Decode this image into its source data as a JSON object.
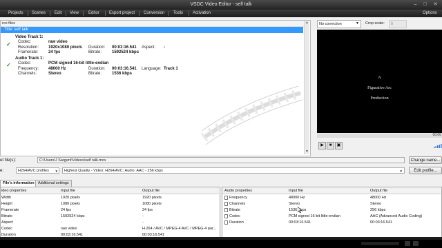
{
  "window": {
    "title": "VSDC Video Editor - self talk"
  },
  "menu": [
    "Projects",
    "Scenes",
    "Edit",
    "View",
    "Editor",
    "Export project",
    "Conversion",
    "Tools",
    "Activation"
  ],
  "menu_right": "Options",
  "source": {
    "header": "rce files",
    "title_row": "Title: self talk",
    "video_track": {
      "heading": "Video Track 1:",
      "codec_k": "Codec:",
      "codec_v": "raw video",
      "res_k": "Resolution:",
      "res_v": "1920x1080 pixels",
      "dur_k": "Duration:",
      "dur_v": "00:03:16.541",
      "aspect_k": "Aspect:",
      "aspect_v": "-",
      "fr_k": "Framerate:",
      "fr_v": "24 fps",
      "br_k": "Bitrate:",
      "br_v": "1592524 kbps"
    },
    "audio_track": {
      "heading": "Audio Track 1:",
      "codec_k": "Codec:",
      "codec_v": "PCM signed 16-bit little-endian",
      "freq_k": "Frequency:",
      "freq_v": "48000 Hz",
      "dur_k": "Duration:",
      "dur_v": "00:03:16.541",
      "lang_k": "Language:",
      "lang_v": "Track 1",
      "ch_k": "Channels:",
      "ch_v": "Stereo",
      "br_k": "Bitrate:",
      "br_v": "1536 kbps"
    }
  },
  "preview": {
    "correction": "No correction",
    "crop_label": "Crop scale:",
    "crop_value": "0",
    "lines": [
      "A",
      "Figurative Arc",
      "Production"
    ],
    "time": "00:00"
  },
  "io": {
    "input_label": "ut file(s):",
    "input_value": "C:\\Users\\J Sargent\\Videos\\self talk.mov",
    "change_btn": "Change name...",
    "profile_label": "e:",
    "format_value": "H264/AVC profiles",
    "quality_value": "Highest Quality - Video: H264/AVC; Audio: AAC - 256 kbps",
    "edit_btn": "Edit profile..."
  },
  "tabs": [
    "File's information",
    "Additional settings"
  ],
  "video_props": {
    "headers": [
      "ideo properties",
      "Input file",
      "Output file"
    ],
    "rows": [
      [
        "Width",
        "1920 pixels",
        "1920 pixels"
      ],
      [
        "Height",
        "1080 pixels",
        "1080 pixels"
      ],
      [
        "Framerate",
        "24 fps",
        "24 fps"
      ],
      [
        "Bitrate",
        "1592524 kbps",
        "-"
      ],
      [
        "Aspect",
        "-",
        "-"
      ],
      [
        "Codec",
        "raw video",
        "H.264 / AVC / MPEG-4 AVC / MPEG-4 par..."
      ],
      [
        "Duration",
        "00:03:16.541",
        "00:03:16.541"
      ]
    ]
  },
  "audio_props": {
    "headers": [
      "Audio properties",
      "Input file",
      "Output file"
    ],
    "rows": [
      [
        "Frequency",
        "48000 Hz",
        "48000 Hz"
      ],
      [
        "Channels",
        "Stereo",
        "Stereo"
      ],
      [
        "Bitrate",
        "1536 kbps",
        "256 kbps"
      ],
      [
        "Codec",
        "PCM signed 16-bit little-endian",
        "AAC (Advanced Audio Coding)"
      ],
      [
        "Duration",
        "00:03:16.541",
        "00:03:16.541"
      ]
    ]
  }
}
